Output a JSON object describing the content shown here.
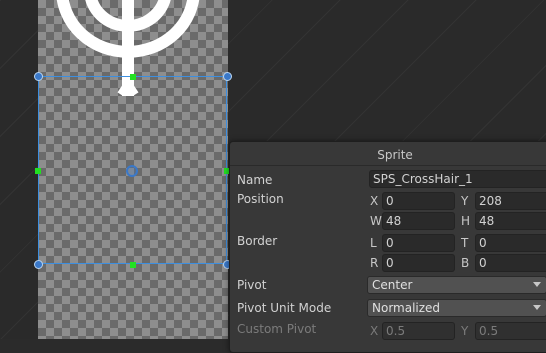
{
  "sprite_editor": {
    "panel_title": "Sprite",
    "name": {
      "label": "Name",
      "value": "SPS_CrossHair_1"
    },
    "position": {
      "label": "Position",
      "x_axis": "X",
      "x_value": "0",
      "y_axis": "Y",
      "y_value": "208",
      "w_axis": "W",
      "w_value": "48",
      "h_axis": "H",
      "h_value": "48"
    },
    "border": {
      "label": "Border",
      "l_axis": "L",
      "l_value": "0",
      "t_axis": "T",
      "t_value": "0",
      "r_axis": "R",
      "r_value": "0",
      "b_axis": "B",
      "b_value": "0"
    },
    "pivot": {
      "label": "Pivot",
      "value": "Center"
    },
    "pivot_unit_mode": {
      "label": "Pivot Unit Mode",
      "value": "Normalized"
    },
    "custom_pivot": {
      "label": "Custom Pivot",
      "x_axis": "X",
      "x_value": "0.5",
      "y_axis": "Y",
      "y_value": "0.5"
    }
  },
  "icons": {
    "sprite_preview": "candelabra-crosshair-sprite",
    "pivot": "pivot-circle-icon",
    "dropdown": "chevron-down-icon"
  },
  "colors": {
    "selection": "#3d8fe0",
    "edge_handles": "#22e022",
    "panel_background": "#383838",
    "field_background": "#2a2a2a"
  }
}
